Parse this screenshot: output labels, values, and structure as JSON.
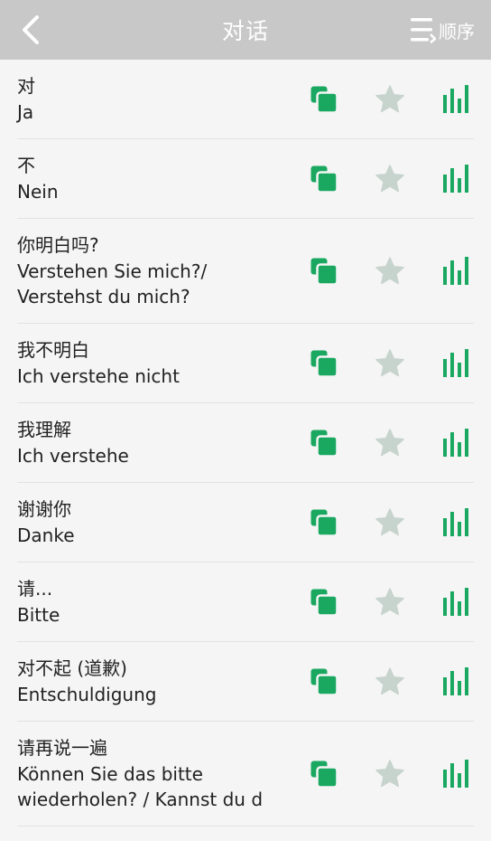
{
  "header": {
    "title": "对话",
    "order_label": "顺序"
  },
  "colors": {
    "header_bg": "#c8c8c8",
    "accent_green": "#1aa861",
    "star_gray": "#c7d3cd"
  },
  "items": [
    {
      "zh": "对",
      "de": "Ja"
    },
    {
      "zh": "不",
      "de": "Nein"
    },
    {
      "zh": "你明白吗?",
      "de": "Verstehen Sie mich?/ Verstehst du mich?"
    },
    {
      "zh": "我不明白",
      "de": "Ich verstehe nicht"
    },
    {
      "zh": "我理解",
      "de": "Ich verstehe"
    },
    {
      "zh": "谢谢你",
      "de": "Danke"
    },
    {
      "zh": "请...",
      "de": "Bitte"
    },
    {
      "zh": "对不起 (道歉)",
      "de": "Entschuldigung"
    },
    {
      "zh": "请再说一遍",
      "de": "Können Sie das bitte wiederholen? / Kannst du d"
    }
  ]
}
